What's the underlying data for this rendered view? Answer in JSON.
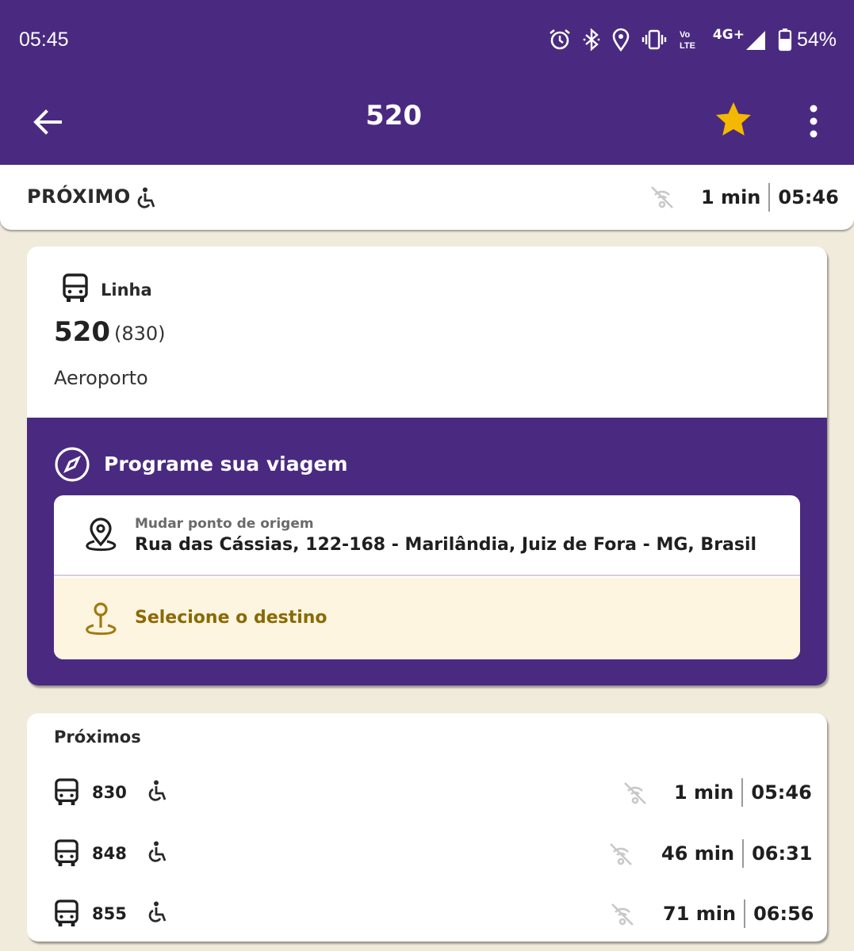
{
  "status_bar": {
    "time": "05:45",
    "network_label": "4G+",
    "volte_label": "Vo LTE",
    "battery": "54%",
    "icons": [
      "alarm-icon",
      "bluetooth-icon",
      "location-icon",
      "vibrate-icon",
      "volte-icon",
      "signal-icon",
      "battery-icon"
    ]
  },
  "app_bar": {
    "title": "520",
    "back_icon": "arrow-left-icon",
    "favorite_icon": "star-icon",
    "menu_icon": "more-vertical-icon",
    "favorite_color": "#f5b800"
  },
  "next_bar": {
    "label": "PRÓXIMO",
    "minutes": "1 min",
    "time": "05:46"
  },
  "line_card": {
    "label": "Linha",
    "number": "520",
    "code": "(830)",
    "destination": "Aeroporto"
  },
  "plan": {
    "title": "Programe sua viagem",
    "origin_small": "Mudar ponto de origem",
    "origin_address": "Rua das Cássias, 122-168 - Marilândia, Juiz de Fora - MG, Brasil",
    "destination_label": "Selecione o destino"
  },
  "upcoming": {
    "header": "Próximos",
    "rows": [
      {
        "vehicle": "830",
        "minutes": "1 min",
        "time": "05:46"
      },
      {
        "vehicle": "848",
        "minutes": "46 min",
        "time": "06:31"
      },
      {
        "vehicle": "855",
        "minutes": "71 min",
        "time": "06:56"
      }
    ]
  },
  "colors": {
    "primary": "#4a2a80",
    "background": "#f0ebdb",
    "destination_bg": "#fdf5e0",
    "destination_text": "#8a6a06"
  }
}
